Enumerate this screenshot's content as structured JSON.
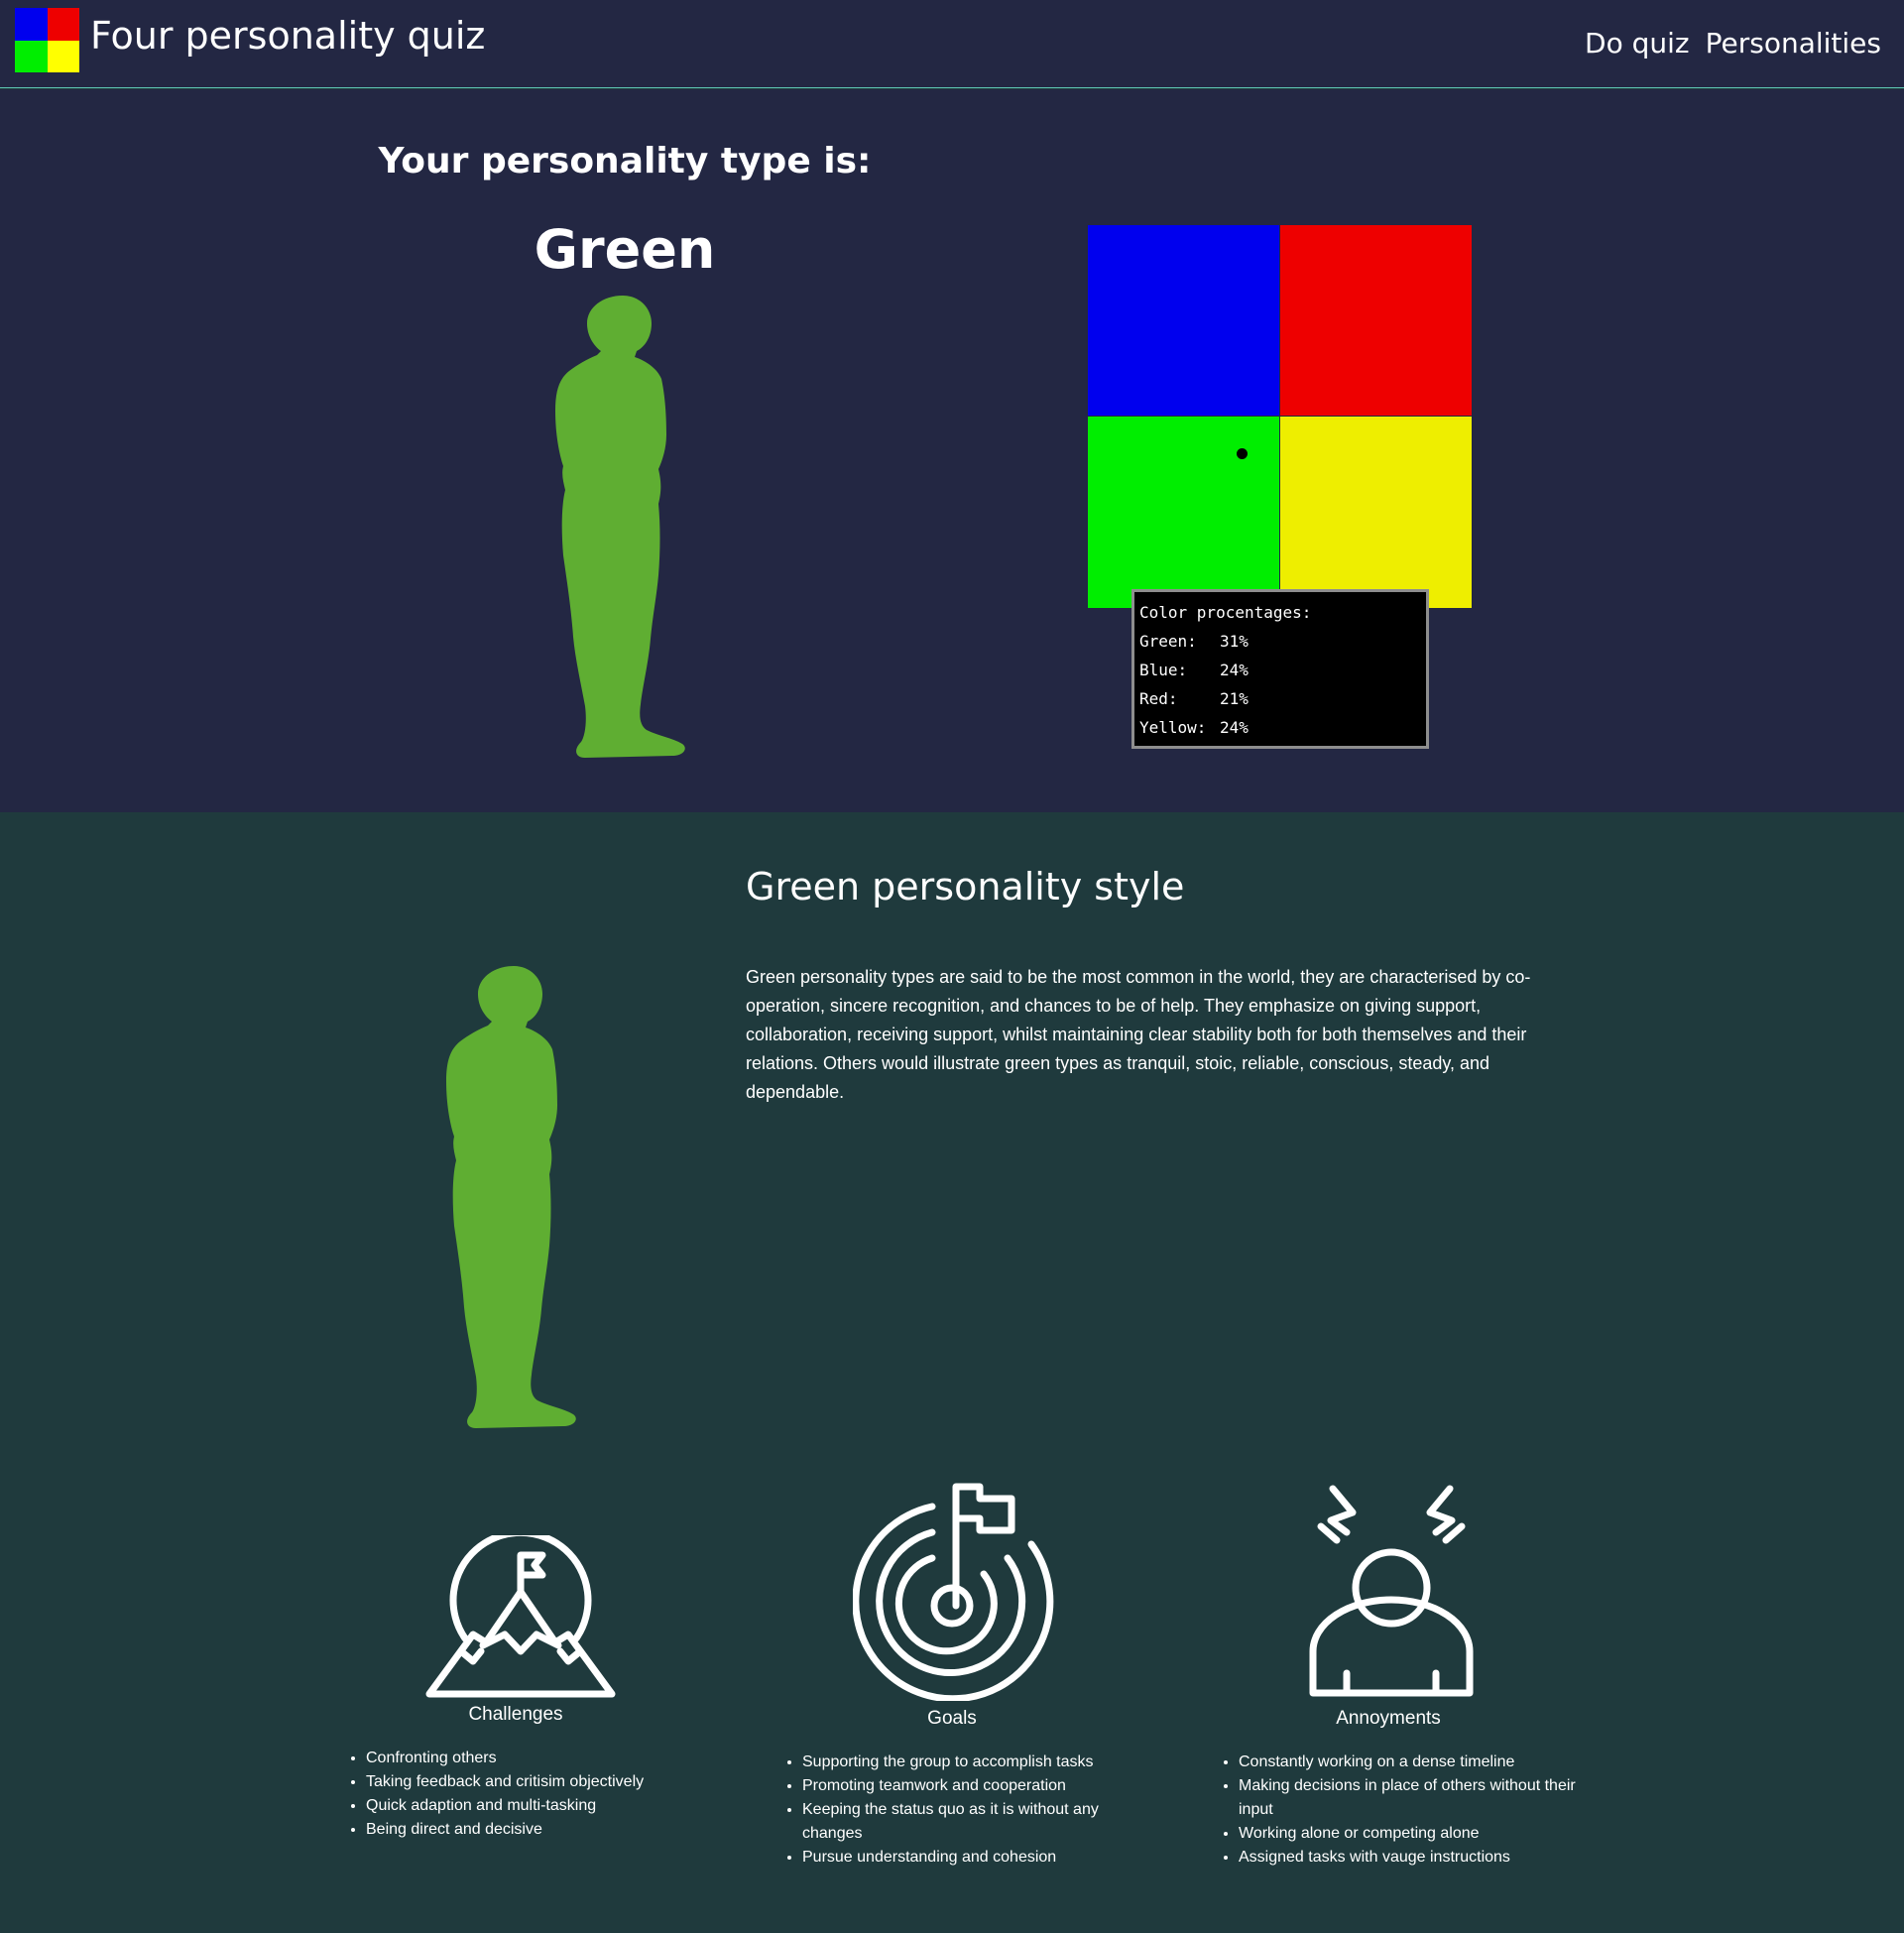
{
  "header": {
    "title": "Four personality quiz",
    "logo_colors": [
      "#0000ee",
      "#ee0000",
      "#00ee00",
      "#ffff00"
    ],
    "nav": [
      {
        "label": "Do quiz"
      },
      {
        "label": "Personalities"
      }
    ]
  },
  "result": {
    "heading": "Your personality type is:",
    "type": "Green",
    "figure_color": "#5fae32",
    "quadrant_colors": {
      "top_left": "#0000ee",
      "top_right": "#ee0000",
      "bottom_left": "#00ee00",
      "bottom_right": "#eeee00"
    },
    "percentages": {
      "title": "Color procentages:",
      "rows": [
        {
          "label": "Green:",
          "value": "31%"
        },
        {
          "label": "Blue:",
          "value": "24%"
        },
        {
          "label": "Red:",
          "value": "21%"
        },
        {
          "label": "Yellow:",
          "value": "24%"
        }
      ]
    }
  },
  "detail": {
    "title": "Green personality style",
    "description": "Green personality types are said to be the most common in the world, they are characterised by co-operation, sincere recognition, and chances to be of help. They emphasize on giving support, collaboration, receiving support, whilst maintaining clear stability both for both themselves and their relations. Others would illustrate green types as tranquil, stoic, reliable, conscious, steady, and dependable."
  },
  "columns": [
    {
      "icon": "mountain-flag-icon",
      "caption": "Challenges",
      "items": [
        "Confronting others",
        "Taking feedback and critisim objectively",
        "Quick adaption and multi-tasking",
        "Being direct and decisive"
      ]
    },
    {
      "icon": "target-flag-icon",
      "caption": "Goals",
      "items": [
        "Supporting the group to accomplish tasks",
        "Promoting teamwork and cooperation",
        "Keeping the status quo as it is without any changes",
        "Pursue understanding and cohesion"
      ]
    },
    {
      "icon": "annoyed-person-icon",
      "caption": "Annoyments",
      "items": [
        "Constantly working on a dense timeline",
        "Making decisions in place of others without their input",
        "Working alone or competing alone",
        "Assigned tasks with vauge instructions"
      ]
    }
  ]
}
